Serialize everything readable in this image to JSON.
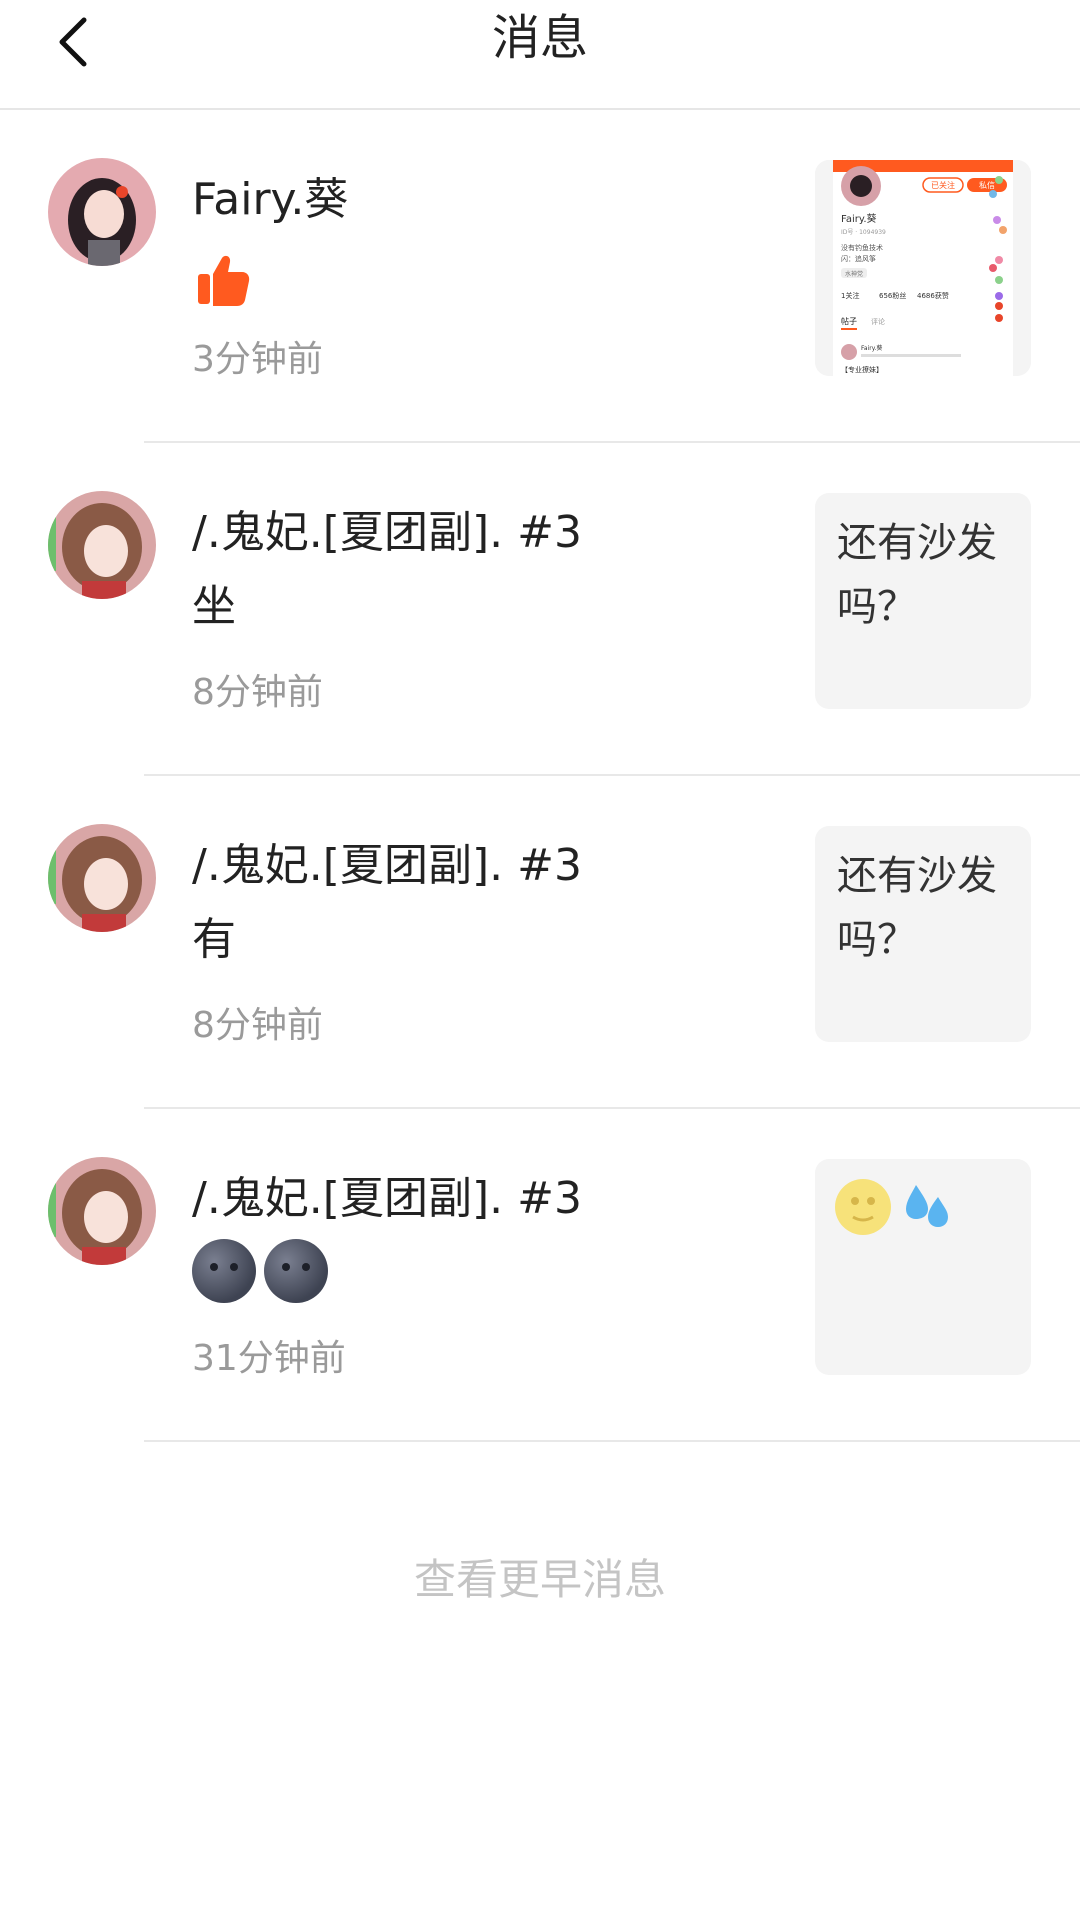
{
  "header": {
    "title": "消息"
  },
  "colors": {
    "accent": "#ff5a1f",
    "divider": "#e8e8e8",
    "time": "#9a9a9a",
    "muted": "#c4c4c4"
  },
  "messages": [
    {
      "name": "Fairy.葵",
      "content_icon": "thumbs-up-icon",
      "time": "3分钟前",
      "thumb": {
        "type": "screenshot",
        "follow_label": "已关注",
        "message_label": "私信",
        "name": "Fairy.葵",
        "id_line": "ID号 · 1094939",
        "bio_line1": "没有钓鱼技术",
        "bio_line2": "闪：追风筝",
        "tag": "水神党",
        "stats": [
          "1关注",
          "656粉丝",
          "4686获赞"
        ],
        "tab1": "帖子",
        "tab2": "评论",
        "post_author": "Fairy.葵",
        "post_text": "【专业撩妹】"
      }
    },
    {
      "name": "/.鬼妃.[夏团副]. #3",
      "content": "坐",
      "time": "8分钟前",
      "thumb": {
        "type": "text",
        "text": "还有沙发吗？"
      }
    },
    {
      "name": "/.鬼妃.[夏团副]. #3",
      "content": "有",
      "time": "8分钟前",
      "thumb": {
        "type": "text",
        "text": "还有沙发吗？"
      }
    },
    {
      "name": "/.鬼妃.[夏团副]. #3",
      "content_icons": [
        "new-moon-face-icon",
        "new-moon-face-icon"
      ],
      "time": "31分钟前",
      "thumb": {
        "type": "emoji",
        "icons": [
          "full-moon-face-icon",
          "sweat-droplets-icon"
        ]
      }
    }
  ],
  "footer": {
    "more_label": "查看更早消息"
  }
}
